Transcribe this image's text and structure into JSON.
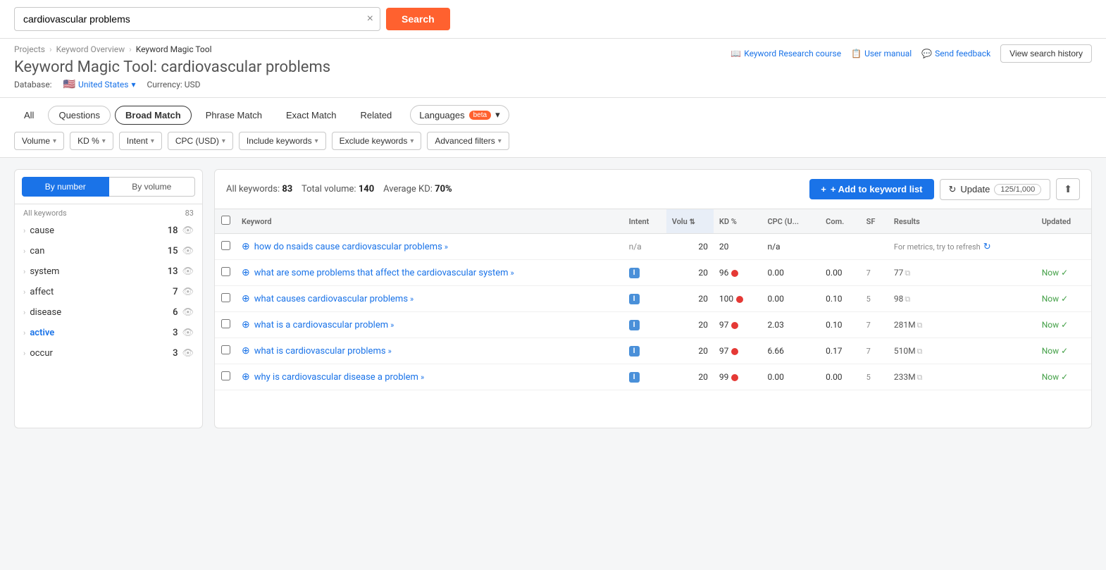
{
  "search": {
    "query": "cardiovascular problems",
    "placeholder": "cardiovascular problems",
    "search_label": "Search",
    "clear_label": "×"
  },
  "breadcrumb": {
    "items": [
      "Projects",
      "Keyword Overview",
      "Keyword Magic Tool"
    ]
  },
  "topnav": {
    "keyword_research_label": "Keyword Research course",
    "user_manual_label": "User manual",
    "send_feedback_label": "Send feedback",
    "view_history_label": "View search history"
  },
  "page": {
    "title_prefix": "Keyword Magic Tool:",
    "title_query": "cardiovascular problems",
    "db_label": "Database:",
    "db_country": "United States",
    "currency_label": "Currency: USD"
  },
  "match_tabs": [
    {
      "id": "all",
      "label": "All",
      "active": false
    },
    {
      "id": "questions",
      "label": "Questions",
      "active": false
    },
    {
      "id": "broad_match",
      "label": "Broad Match",
      "active": true
    },
    {
      "id": "phrase_match",
      "label": "Phrase Match",
      "active": false
    },
    {
      "id": "exact_match",
      "label": "Exact Match",
      "active": false
    },
    {
      "id": "related",
      "label": "Related",
      "active": false
    }
  ],
  "languages_btn": "Languages",
  "beta_label": "beta",
  "filters": [
    {
      "id": "volume",
      "label": "Volume"
    },
    {
      "id": "kd",
      "label": "KD %"
    },
    {
      "id": "intent",
      "label": "Intent"
    },
    {
      "id": "cpc",
      "label": "CPC (USD)"
    },
    {
      "id": "include",
      "label": "Include keywords"
    },
    {
      "id": "exclude",
      "label": "Exclude keywords"
    },
    {
      "id": "advanced",
      "label": "Advanced filters"
    }
  ],
  "sidebar": {
    "tab_by_number": "By number",
    "tab_by_volume": "By volume",
    "header_left": "All keywords",
    "header_count": "83",
    "items": [
      {
        "id": "cause",
        "label": "cause",
        "count": 18
      },
      {
        "id": "can",
        "label": "can",
        "count": 15
      },
      {
        "id": "system",
        "label": "system",
        "count": 13
      },
      {
        "id": "affect",
        "label": "affect",
        "count": 7
      },
      {
        "id": "disease",
        "label": "disease",
        "count": 6
      },
      {
        "id": "active",
        "label": "active",
        "count": 3,
        "highlight": true
      },
      {
        "id": "occur",
        "label": "occur",
        "count": 3
      }
    ]
  },
  "table": {
    "stats": {
      "all_keywords_label": "All keywords:",
      "all_keywords_count": "83",
      "total_volume_label": "Total volume:",
      "total_volume_count": "140",
      "avg_kd_label": "Average KD:",
      "avg_kd_value": "70%"
    },
    "actions": {
      "add_kw_label": "+ Add to keyword list",
      "update_label": "Update",
      "update_count": "125/1,000"
    },
    "columns": [
      "",
      "Keyword",
      "Intent",
      "Volume",
      "KD %",
      "CPC (U...",
      "Com.",
      "SF",
      "Results",
      "Updated"
    ],
    "rows": [
      {
        "keyword": "how do nsaids cause cardiovascular problems",
        "intent": "n/a",
        "volume": "20",
        "kd": "20",
        "kd_dot": "none",
        "cpc": "n/a",
        "com": "",
        "sf": "",
        "results": "For metrics, try to refresh",
        "refresh": true,
        "updated": ""
      },
      {
        "keyword": "what are some problems that affect the cardiovascular system",
        "intent": "I",
        "volume": "20",
        "kd": "96",
        "kd_dot": "red",
        "cpc": "0.00",
        "com": "0.00",
        "sf": "7",
        "results": "77",
        "refresh": false,
        "updated": "Now ✓"
      },
      {
        "keyword": "what causes cardiovascular problems",
        "intent": "I",
        "volume": "20",
        "kd": "100",
        "kd_dot": "red",
        "cpc": "0.00",
        "com": "0.10",
        "sf": "5",
        "results": "98",
        "refresh": false,
        "updated": "Now ✓"
      },
      {
        "keyword": "what is a cardiovascular problem",
        "intent": "I",
        "volume": "20",
        "kd": "97",
        "kd_dot": "red",
        "cpc": "2.03",
        "com": "0.10",
        "sf": "7",
        "results": "281M",
        "refresh": false,
        "updated": "Now ✓"
      },
      {
        "keyword": "what is cardiovascular problems",
        "intent": "I",
        "volume": "20",
        "kd": "97",
        "kd_dot": "red",
        "cpc": "6.66",
        "com": "0.17",
        "sf": "7",
        "results": "510M",
        "refresh": false,
        "updated": "Now ✓"
      },
      {
        "keyword": "why is cardiovascular disease a problem",
        "intent": "I",
        "volume": "20",
        "kd": "99",
        "kd_dot": "red",
        "cpc": "0.00",
        "com": "0.00",
        "sf": "5",
        "results": "233M",
        "refresh": false,
        "updated": "Now ✓"
      }
    ]
  },
  "icons": {
    "search": "🔍",
    "flag_us": "🇺🇸",
    "chevron_down": "▾",
    "chevron_right": "›",
    "eye": "👁",
    "refresh": "↻",
    "export": "⬆",
    "plus": "+",
    "sort": "⇅",
    "copy": "⧉",
    "add_circle": "⊕",
    "book": "📖",
    "manual": "📋",
    "feedback": "💬"
  }
}
